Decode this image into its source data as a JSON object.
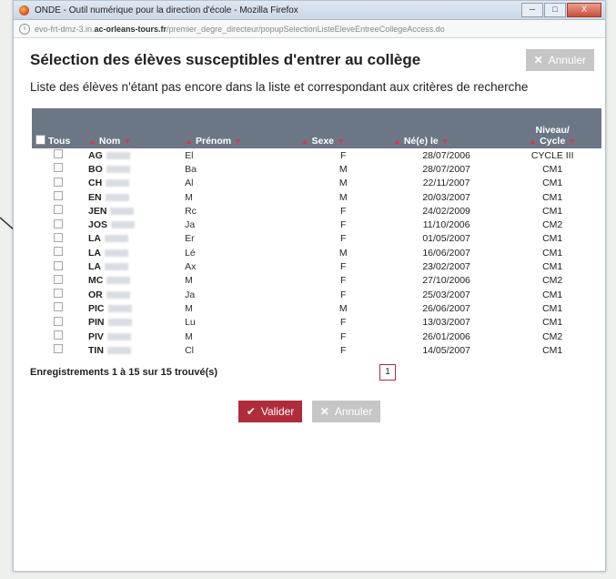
{
  "window": {
    "title": "ONDE - Outil numérique pour la direction d'école - Mozilla Firefox",
    "url_prefix": "evo-frt-dmz-3.in.",
    "url_domain": "ac-orleans-tours.fr",
    "url_path": "/premier_degre_directeur/popupSelectionListeEleveEntreeCollegeAccess.do",
    "btn_minimize": "─",
    "btn_maximize": "□",
    "btn_close": "X"
  },
  "page": {
    "title": "Sélection des élèves susceptibles d'entrer au collège",
    "subtitle": "Liste des élèves n'étant pas encore dans la liste et correspondant aux critères de recherche",
    "cancel_label": "Annuler"
  },
  "table": {
    "headers": {
      "tous": "Tous",
      "nom": "Nom",
      "prenom": "Prénom",
      "sexe": "Sexe",
      "ne_le": "Né(e) le",
      "niveau_line1": "Niveau/",
      "niveau_line2": "Cycle"
    },
    "rows": [
      {
        "nom": "AG",
        "prenom": "El",
        "sexe": "F",
        "date": "28/07/2006",
        "niveau": "CYCLE III"
      },
      {
        "nom": "BO",
        "prenom": "Ba",
        "sexe": "M",
        "date": "28/07/2007",
        "niveau": "CM1"
      },
      {
        "nom": "CH",
        "prenom": "Al",
        "sexe": "M",
        "date": "22/11/2007",
        "niveau": "CM1"
      },
      {
        "nom": "EN",
        "prenom": "M",
        "sexe": "M",
        "date": "20/03/2007",
        "niveau": "CM1"
      },
      {
        "nom": "JEN",
        "prenom": "Rc",
        "sexe": "F",
        "date": "24/02/2009",
        "niveau": "CM1"
      },
      {
        "nom": "JOS",
        "prenom": "Ja",
        "sexe": "F",
        "date": "11/10/2006",
        "niveau": "CM2"
      },
      {
        "nom": "LA",
        "prenom": "Er",
        "sexe": "F",
        "date": "01/05/2007",
        "niveau": "CM1"
      },
      {
        "nom": "LA",
        "prenom": "Lé",
        "sexe": "M",
        "date": "16/06/2007",
        "niveau": "CM1"
      },
      {
        "nom": "LA",
        "prenom": "Ax",
        "sexe": "F",
        "date": "23/02/2007",
        "niveau": "CM1"
      },
      {
        "nom": "MC",
        "prenom": "M",
        "sexe": "F",
        "date": "27/10/2006",
        "niveau": "CM2"
      },
      {
        "nom": "OR",
        "prenom": "Ja",
        "sexe": "F",
        "date": "25/03/2007",
        "niveau": "CM1"
      },
      {
        "nom": "PIC",
        "prenom": "M",
        "sexe": "M",
        "date": "26/06/2007",
        "niveau": "CM1"
      },
      {
        "nom": "PIN",
        "prenom": "Lu",
        "sexe": "F",
        "date": "13/03/2007",
        "niveau": "CM1"
      },
      {
        "nom": "PIV",
        "prenom": "M",
        "sexe": "F",
        "date": "26/01/2006",
        "niveau": "CM2"
      },
      {
        "nom": "TIN",
        "prenom": "Cl",
        "sexe": "F",
        "date": "14/05/2007",
        "niveau": "CM1"
      }
    ]
  },
  "footer": {
    "records": "Enregistrements 1 à 15 sur 15 trouvé(s)",
    "page": "1",
    "validate_label": "Valider",
    "cancel_label": "Annuler"
  },
  "colors": {
    "accent_red": "#b12c3a",
    "header_grey": "#6b7785",
    "button_grey": "#c6c6c6"
  }
}
